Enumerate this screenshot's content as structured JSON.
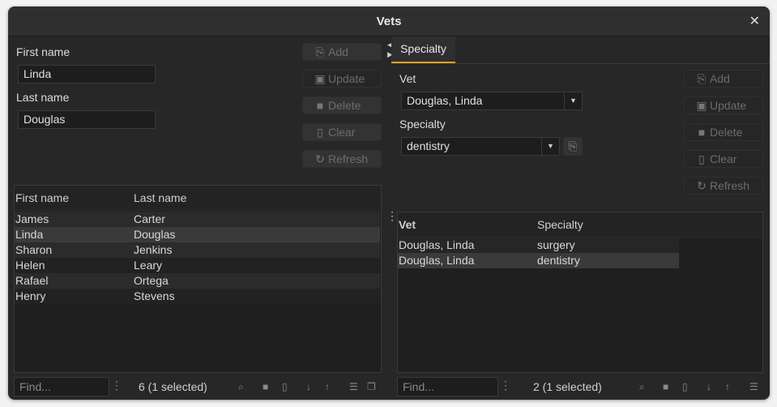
{
  "window": {
    "title": "Vets",
    "close_icon": "close-icon"
  },
  "left": {
    "first_name_label": "First name",
    "first_name_value": "Linda",
    "last_name_label": "Last name",
    "last_name_value": "Douglas",
    "buttons": [
      {
        "label": "Add",
        "icon": "file-add-icon"
      },
      {
        "label": "Update",
        "icon": "save-icon"
      },
      {
        "label": "Delete",
        "icon": "trash-icon"
      },
      {
        "label": "Clear",
        "icon": "file-icon"
      },
      {
        "label": "Refresh",
        "icon": "refresh-icon"
      }
    ],
    "table": {
      "columns": [
        "First name",
        "Last name"
      ],
      "rows": [
        [
          "James",
          "Carter"
        ],
        [
          "Linda",
          "Douglas"
        ],
        [
          "Sharon",
          "Jenkins"
        ],
        [
          "Helen",
          "Leary"
        ],
        [
          "Rafael",
          "Ortega"
        ],
        [
          "Henry",
          "Stevens"
        ]
      ],
      "selected_row": 1
    },
    "footer": {
      "find_placeholder": "Find...",
      "count": "6 (1 selected)"
    }
  },
  "right": {
    "tab": "Specialty",
    "accent": "#f0a020",
    "vet_label": "Vet",
    "vet_value": "Douglas, Linda",
    "specialty_label": "Specialty",
    "specialty_value": "dentistry",
    "buttons": [
      {
        "label": "Add",
        "icon": "file-add-icon"
      },
      {
        "label": "Update",
        "icon": "save-icon"
      },
      {
        "label": "Delete",
        "icon": "trash-icon"
      },
      {
        "label": "Clear",
        "icon": "file-icon"
      },
      {
        "label": "Refresh",
        "icon": "refresh-icon"
      }
    ],
    "table": {
      "columns": [
        "Vet",
        "Specialty"
      ],
      "rows": [
        [
          "Douglas, Linda",
          "surgery"
        ],
        [
          "Douglas, Linda",
          "dentistry"
        ]
      ],
      "selected_row": 1
    },
    "footer": {
      "find_placeholder": "Find...",
      "count": "2 (1 selected)"
    }
  }
}
